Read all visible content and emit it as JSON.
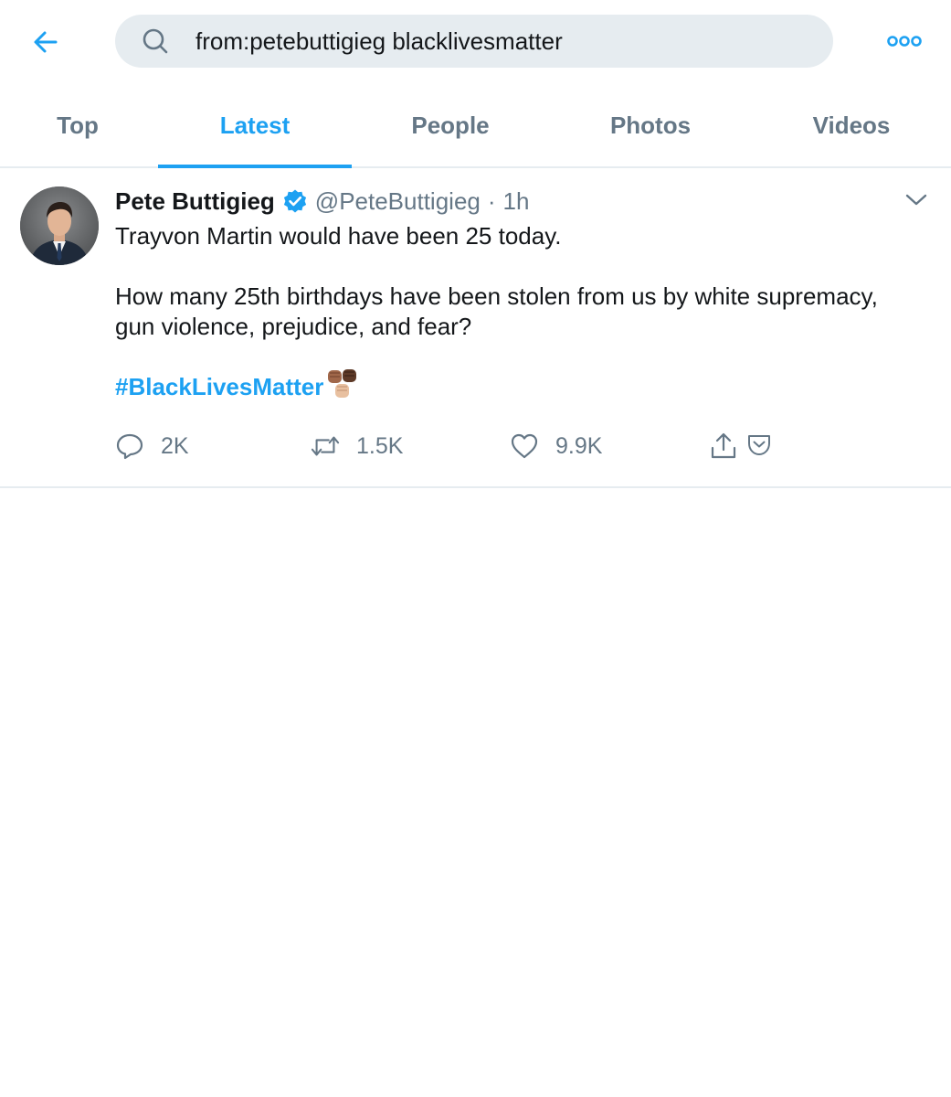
{
  "search": {
    "query": "from:petebuttigieg blacklivesmatter"
  },
  "tabs": [
    {
      "label": "Top"
    },
    {
      "label": "Latest"
    },
    {
      "label": "People"
    },
    {
      "label": "Photos"
    },
    {
      "label": "Videos"
    }
  ],
  "active_tab": "Latest",
  "tweet": {
    "author_name": "Pete Buttigieg",
    "handle": "@PeteButtigieg",
    "separator": "·",
    "time": "1h",
    "lines": [
      "Trayvon Martin would have been 25 today.",
      "How many 25th birthdays have been stolen from us by white supremacy, gun violence, prejudice, and fear?"
    ],
    "hashtag": "#BlackLivesMatter",
    "emoji": "raised-fists-emoji",
    "stats": {
      "replies": "2K",
      "retweets": "1.5K",
      "likes": "9.9K"
    }
  },
  "colors": {
    "accent": "#1da1f2",
    "muted": "#657786",
    "text": "#14171a",
    "search_bg": "#e6ecf0"
  },
  "icons": [
    "back-arrow-icon",
    "search-icon",
    "more-icon",
    "verified-icon",
    "chevron-down-icon",
    "reply-icon",
    "retweet-icon",
    "like-icon",
    "share-icon",
    "pocket-icon"
  ]
}
